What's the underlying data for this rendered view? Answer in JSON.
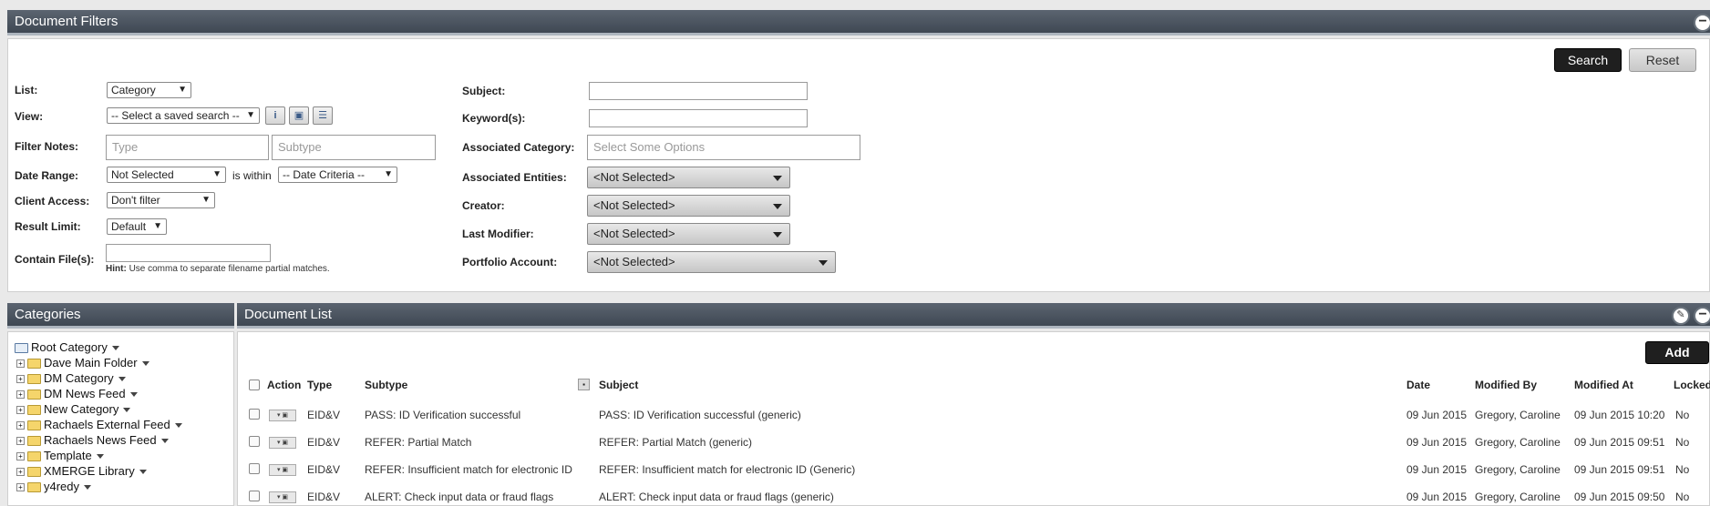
{
  "filters": {
    "title": "Document Filters",
    "search_label": "Search",
    "reset_label": "Reset",
    "list_label": "List:",
    "list_value": "Category",
    "view_label": "View:",
    "view_value": "-- Select a saved search --",
    "filter_notes_label": "Filter Notes:",
    "type_placeholder": "Type",
    "subtype_placeholder": "Subtype",
    "date_range_label": "Date Range:",
    "date_range_value": "Not Selected",
    "is_within_label": "is within",
    "date_criteria_value": "-- Date Criteria --",
    "client_access_label": "Client Access:",
    "client_access_value": "Don't filter",
    "result_limit_label": "Result Limit:",
    "result_limit_value": "Default",
    "contain_files_label": "Contain File(s):",
    "hint_bold": "Hint:",
    "hint_text": "Use comma to separate filename partial matches.",
    "subject_label": "Subject:",
    "keywords_label": "Keyword(s):",
    "assoc_category_label": "Associated Category:",
    "assoc_category_placeholder": "Select Some Options",
    "assoc_entities_label": "Associated Entities:",
    "assoc_entities_value": "<Not Selected>",
    "creator_label": "Creator:",
    "creator_value": "<Not Selected>",
    "last_modifier_label": "Last Modifier:",
    "last_modifier_value": "<Not Selected>",
    "portfolio_label": "Portfolio Account:",
    "portfolio_value": "<Not Selected>"
  },
  "categories": {
    "title": "Categories",
    "root": "Root Category",
    "items": [
      "Dave Main Folder",
      "DM Category",
      "DM News Feed",
      "New Category",
      "Rachaels External Feed",
      "Rachaels News Feed",
      "Template",
      "XMERGE Library",
      "y4redy"
    ]
  },
  "document_list": {
    "title": "Document List",
    "add_label": "Add",
    "columns": {
      "action": "Action",
      "type": "Type",
      "subtype": "Subtype",
      "subject": "Subject",
      "date": "Date",
      "modified_by": "Modified By",
      "modified_at": "Modified At",
      "locked": "Locked"
    },
    "rows": [
      {
        "type": "EID&V",
        "subtype": "PASS: ID Verification successful",
        "subject": "PASS: ID Verification successful (generic)",
        "date": "09 Jun 2015",
        "modified_by": "Gregory, Caroline",
        "modified_at": "09 Jun 2015 10:20",
        "locked": "No"
      },
      {
        "type": "EID&V",
        "subtype": "REFER: Partial Match",
        "subject": "REFER: Partial Match (generic)",
        "date": "09 Jun 2015",
        "modified_by": "Gregory, Caroline",
        "modified_at": "09 Jun 2015 09:51",
        "locked": "No"
      },
      {
        "type": "EID&V",
        "subtype": "REFER: Insufficient match for electronic ID",
        "subject": "REFER: Insufficient match for electronic ID (Generic)",
        "date": "09 Jun 2015",
        "modified_by": "Gregory, Caroline",
        "modified_at": "09 Jun 2015 09:51",
        "locked": "No"
      },
      {
        "type": "EID&V",
        "subtype": "ALERT: Check input data or fraud flags",
        "subject": "ALERT: Check input data or fraud flags (generic)",
        "date": "09 Jun 2015",
        "modified_by": "Gregory, Caroline",
        "modified_at": "09 Jun 2015 09:50",
        "locked": "No"
      }
    ]
  }
}
